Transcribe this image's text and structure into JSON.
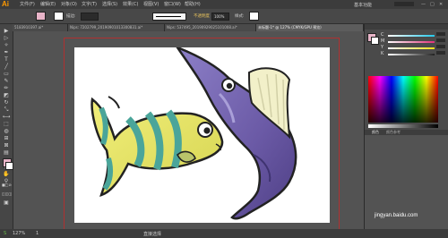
{
  "app": {
    "logo": "Ai",
    "brand_color": "#ff9a00"
  },
  "menu": {
    "items": [
      "文件(F)",
      "编辑(E)",
      "对象(O)",
      "文字(T)",
      "选择(S)",
      "效果(C)",
      "视图(V)",
      "窗口(W)",
      "帮助(H)"
    ],
    "workspace": "基本功能",
    "search_icon": "search-icon"
  },
  "control": {
    "fill_color": "#e8b4c8",
    "stroke_color": "#ffffff",
    "stroke_label": "描边:",
    "style_label": "不透明度",
    "opacity_value": "100%",
    "style_text": "样式:"
  },
  "tabs": [
    {
      "label": "5183910397.ai*",
      "active": false
    },
    {
      "label": "Nips: 7202799_20190901013300831.ai*",
      "active": false
    },
    {
      "label": "Nips: 537495_20190929025101008.ai*",
      "active": false
    },
    {
      "label": "未标题-1* @ 127% (CMYK/GPU 预览)",
      "active": true
    }
  ],
  "panel": {
    "color_labels": [
      "C",
      "M",
      "Y",
      "K"
    ],
    "slider_colors": [
      "#25c8ea",
      "#e0307a",
      "#f3e01a",
      "#6b6b6b"
    ],
    "tab_labels": [
      "颜色",
      "颜色参考"
    ]
  },
  "status": {
    "zoom": "127%",
    "page": "1",
    "mode": "直接选择"
  },
  "watermark": {
    "text": "jingyan.baidu.com"
  }
}
